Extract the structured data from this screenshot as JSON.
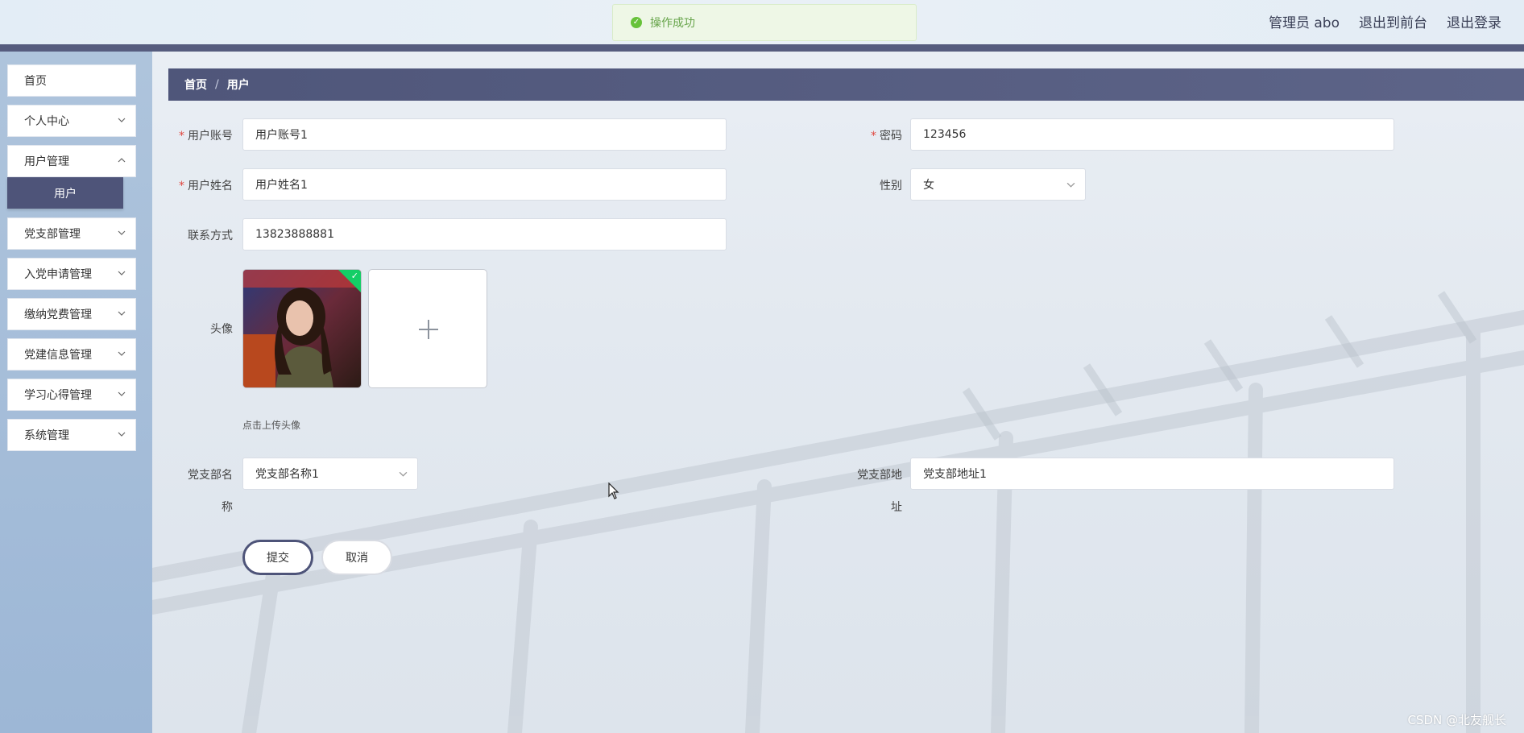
{
  "header": {
    "admin_label": "管理员 abo",
    "to_front_label": "退出到前台",
    "logout_label": "退出登录"
  },
  "toast": {
    "message": "操作成功"
  },
  "sidebar": {
    "items": [
      {
        "label": "首页"
      },
      {
        "label": "个人中心"
      },
      {
        "label": "用户管理"
      },
      {
        "label": "党支部管理"
      },
      {
        "label": "入党申请管理"
      },
      {
        "label": "缴纳党费管理"
      },
      {
        "label": "党建信息管理"
      },
      {
        "label": "学习心得管理"
      },
      {
        "label": "系统管理"
      }
    ],
    "submenu_label": "用户"
  },
  "breadcrumb": {
    "home": "首页",
    "separator": "/",
    "current": "用户"
  },
  "form": {
    "account_label": "用户账号",
    "account_value": "用户账号1",
    "password_label": "密码",
    "password_value": "123456",
    "name_label": "用户姓名",
    "name_value": "用户姓名1",
    "gender_label": "性别",
    "gender_value": "女",
    "contact_label": "联系方式",
    "contact_value": "13823888881",
    "avatar_label": "头像",
    "avatar_hint": "点击上传头像",
    "branch_name_label_1": "党支部名",
    "branch_name_label_2": "称",
    "branch_name_value": "党支部名称1",
    "branch_addr_label_1": "党支部地",
    "branch_addr_label_2": "址",
    "branch_addr_value": "党支部地址1",
    "submit_label": "提交",
    "cancel_label": "取消"
  },
  "watermark": "CSDN @北友舰长"
}
